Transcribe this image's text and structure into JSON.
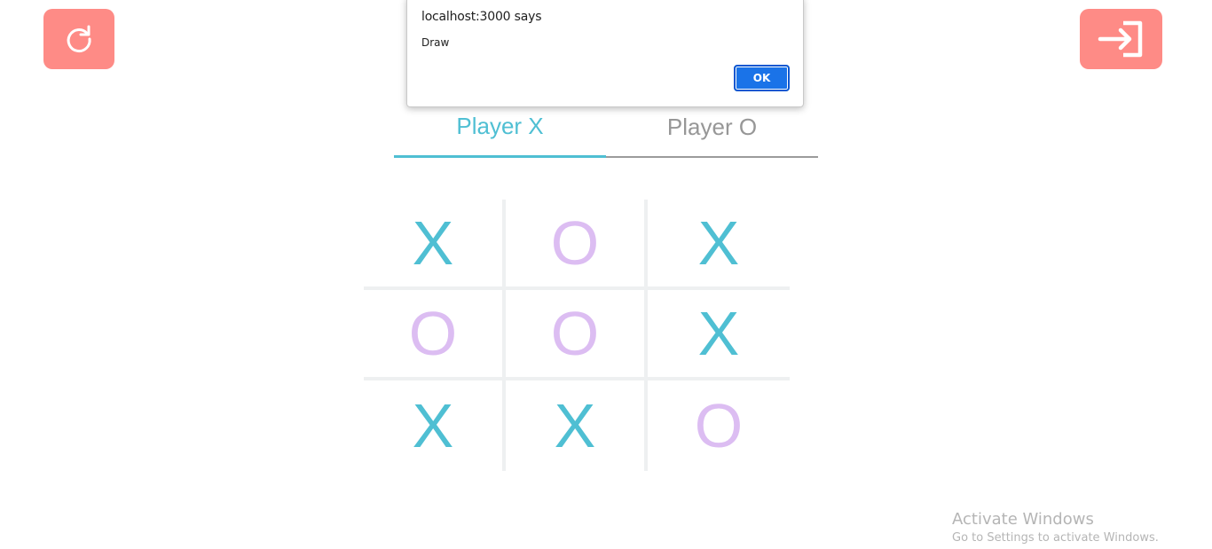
{
  "header": {
    "restart_icon": "refresh-icon",
    "exit_icon": "sign-in-icon",
    "button_color": "#fe8b86"
  },
  "tabs": [
    {
      "label": "Player X",
      "active": true
    },
    {
      "label": "Player O",
      "active": false
    }
  ],
  "board": {
    "cells": [
      [
        "X",
        "O",
        "X"
      ],
      [
        "O",
        "O",
        "X"
      ],
      [
        "X",
        "X",
        "O"
      ]
    ],
    "x_color": "#4fbfd3",
    "o_color": "#dcbdf2"
  },
  "dialog": {
    "title": "localhost:3000 says",
    "message": "Draw",
    "ok_label": "OK"
  },
  "watermark": {
    "title": "Activate Windows",
    "subtitle": "Go to Settings to activate Windows."
  }
}
